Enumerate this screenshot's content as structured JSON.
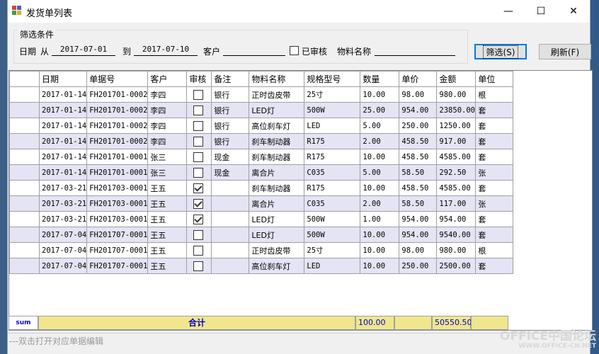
{
  "window": {
    "title": "发货单列表",
    "minimize_glyph": "—",
    "maximize_glyph": "☐",
    "close_glyph": "✕"
  },
  "filter": {
    "group_title": "筛选条件",
    "date_label": "日期",
    "from_label": "从",
    "from_value": "2017-07-01",
    "to_label": "到",
    "to_value": "2017-07-10",
    "customer_label": "客户",
    "customer_value": "",
    "audited_label": "已审核",
    "audited_checked": false,
    "material_label": "物料名称",
    "material_value": ""
  },
  "buttons": {
    "filter_label": "筛选(S)",
    "refresh_label": "刷新(F)"
  },
  "table": {
    "columns": [
      "日期",
      "单据号",
      "客户",
      "审核",
      "备注",
      "物料名称",
      "规格型号",
      "数量",
      "单价",
      "金额",
      "单位"
    ],
    "rows": [
      {
        "date": "2017-01-14",
        "no": "FH201701-0002",
        "customer": "李四",
        "audited": false,
        "note": "银行",
        "material": "正时齿皮带",
        "spec": "25寸",
        "qty": "10.00",
        "price": "98.00",
        "amount": "980.00",
        "unit": "根"
      },
      {
        "date": "2017-01-14",
        "no": "FH201701-0002",
        "customer": "李四",
        "audited": false,
        "note": "银行",
        "material": "LED灯",
        "spec": "500W",
        "qty": "25.00",
        "price": "954.00",
        "amount": "23850.00",
        "unit": "套"
      },
      {
        "date": "2017-01-14",
        "no": "FH201701-0002",
        "customer": "李四",
        "audited": false,
        "note": "银行",
        "material": "高位刹车灯",
        "spec": "LED",
        "qty": "5.00",
        "price": "250.00",
        "amount": "1250.00",
        "unit": "套"
      },
      {
        "date": "2017-01-14",
        "no": "FH201701-0002",
        "customer": "李四",
        "audited": false,
        "note": "银行",
        "material": "刹车制动器",
        "spec": "R175",
        "qty": "2.00",
        "price": "458.50",
        "amount": "917.00",
        "unit": "套"
      },
      {
        "date": "2017-01-14",
        "no": "FH201701-0001",
        "customer": "张三",
        "audited": false,
        "note": "现金",
        "material": "刹车制动器",
        "spec": "R175",
        "qty": "10.00",
        "price": "458.50",
        "amount": "4585.00",
        "unit": "套"
      },
      {
        "date": "2017-01-14",
        "no": "FH201701-0001",
        "customer": "张三",
        "audited": false,
        "note": "现金",
        "material": "离合片",
        "spec": "C035",
        "qty": "5.00",
        "price": "58.50",
        "amount": "292.50",
        "unit": "张"
      },
      {
        "date": "2017-03-21",
        "no": "FH201703-0001",
        "customer": "王五",
        "audited": true,
        "note": "",
        "material": "刹车制动器",
        "spec": "R175",
        "qty": "10.00",
        "price": "458.50",
        "amount": "4585.00",
        "unit": "套"
      },
      {
        "date": "2017-03-21",
        "no": "FH201703-0001",
        "customer": "王五",
        "audited": true,
        "note": "",
        "material": "离合片",
        "spec": "C035",
        "qty": "2.00",
        "price": "58.50",
        "amount": "117.00",
        "unit": "张"
      },
      {
        "date": "2017-03-21",
        "no": "FH201703-0001",
        "customer": "王五",
        "audited": true,
        "note": "",
        "material": "LED灯",
        "spec": "500W",
        "qty": "1.00",
        "price": "954.00",
        "amount": "954.00",
        "unit": "套"
      },
      {
        "date": "2017-07-04",
        "no": "FH201707-0001",
        "customer": "王五",
        "audited": false,
        "note": "",
        "material": "LED灯",
        "spec": "500W",
        "qty": "10.00",
        "price": "954.00",
        "amount": "9540.00",
        "unit": "套"
      },
      {
        "date": "2017-07-04",
        "no": "FH201707-0001",
        "customer": "王五",
        "audited": false,
        "note": "",
        "material": "正时齿皮带",
        "spec": "25寸",
        "qty": "10.00",
        "price": "98.00",
        "amount": "980.00",
        "unit": "根"
      },
      {
        "date": "2017-07-04",
        "no": "FH201707-0001",
        "customer": "王五",
        "audited": false,
        "note": "",
        "material": "高位刹车灯",
        "spec": "LED",
        "qty": "10.00",
        "price": "250.00",
        "amount": "2500.00",
        "unit": "套"
      }
    ]
  },
  "summary": {
    "row_header": "sum",
    "label": "合计",
    "qty_total": "100.00",
    "amount_total": "50550.50"
  },
  "status": {
    "hint": "---双击打开对应单据编辑"
  },
  "watermark": {
    "line1": "OFFICE中国论坛",
    "line2": "WWW.OFFICE-CN.NET"
  },
  "colors": {
    "alt_row": "#e4e4f5",
    "summary_bg": "#f0e68c",
    "summary_text": "#0000cc",
    "focus_border": "#0078d7"
  }
}
